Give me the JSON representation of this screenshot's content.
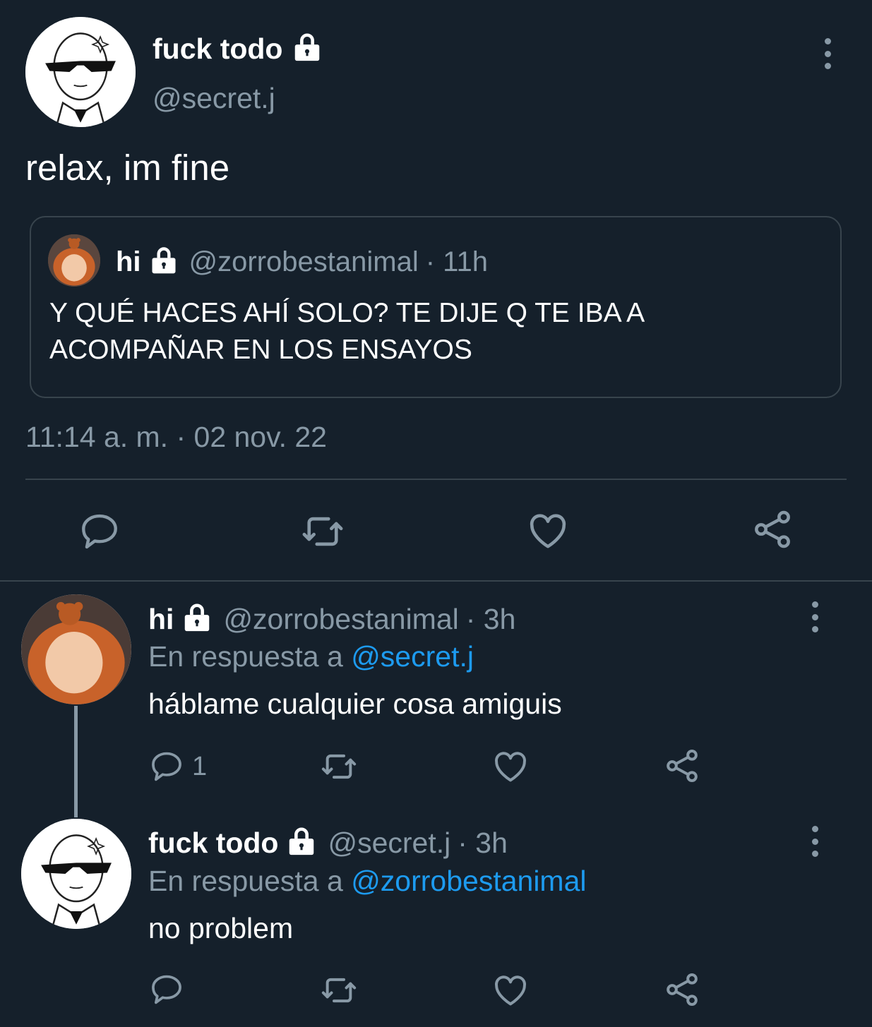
{
  "main_tweet": {
    "display_name": "fuck todo",
    "handle": "@secret.j",
    "text": "relax, im fine",
    "timestamp": "11:14 a. m. · 02 nov. 22",
    "avatar": "lineart-sunglasses-avatar",
    "quote": {
      "display_name": "hi",
      "handle": "@zorrobestanimal",
      "time": "· 11h",
      "text_line1": "Y QUÉ HACES AHÍ SOLO? TE DIJE Q TE IBA A",
      "text_line2": "ACOMPAÑAR EN LOS ENSAYOS",
      "avatar": "orange-plush-bear-avatar"
    }
  },
  "replies": [
    {
      "display_name": "hi",
      "handle": "@zorrobestanimal",
      "time": "· 3h",
      "reply_prefix": "En respuesta a ",
      "reply_to": "@secret.j",
      "text": "háblame cualquier cosa amiguis",
      "reply_count": "1",
      "avatar": "orange-plush-bear-avatar"
    },
    {
      "display_name": "fuck todo",
      "handle": "@secret.j",
      "time": "· 3h",
      "reply_prefix": "En respuesta a ",
      "reply_to": "@zorrobestanimal",
      "text": "no problem",
      "reply_count": "",
      "avatar": "lineart-sunglasses-avatar"
    }
  ],
  "icons": {
    "reply": "speech-bubble-icon",
    "retweet": "retweet-arrows-icon",
    "like": "heart-icon",
    "share": "share-nodes-icon",
    "more": "vertical-dots-icon",
    "protected": "lock-icon"
  },
  "colors": {
    "background": "#15202b",
    "muted": "#8899a6",
    "link": "#1d9bf0",
    "border": "#38444d"
  }
}
